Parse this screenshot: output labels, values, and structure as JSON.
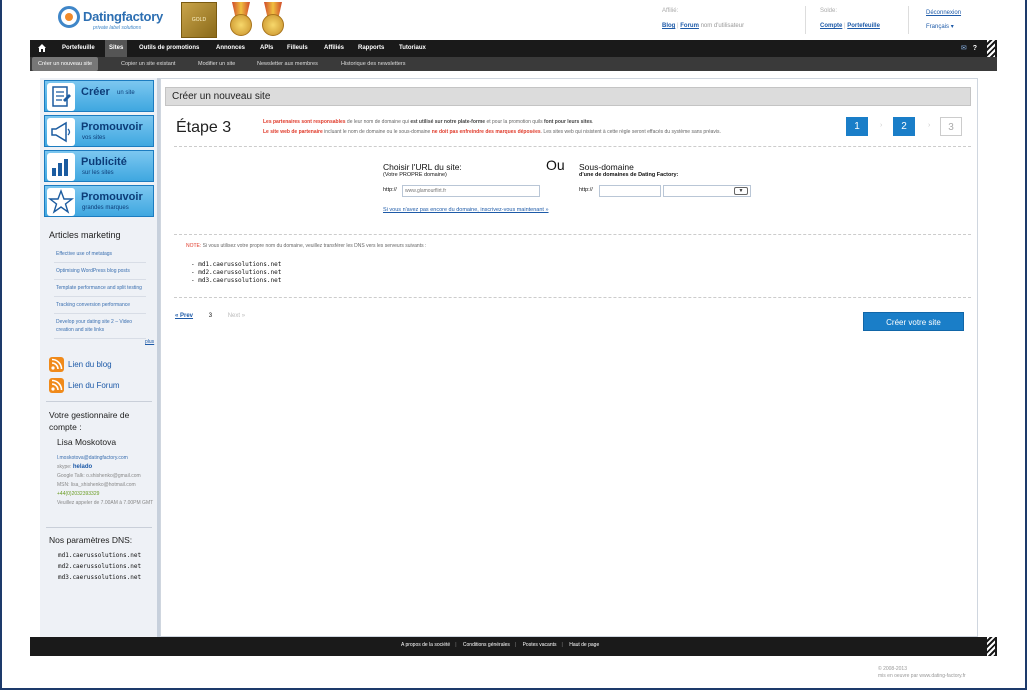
{
  "header": {
    "logo_name": "Datingfactory",
    "logo_tagline": "private label solutions",
    "award_text": "GOLD",
    "affiliate": {
      "label": "Affilié:",
      "blog": "Blog",
      "forum": "Forum",
      "suffix": "nom d'utilisateur"
    },
    "balance": {
      "label": "Solde:",
      "compte": "Compte",
      "portefeuille": "Portefeuille"
    },
    "account": {
      "logout": "Déconnexion",
      "language": "Français"
    }
  },
  "nav": {
    "items": [
      "Portefeuille",
      "Sites",
      "Outils de promotions",
      "Annonces",
      "APIs",
      "Filleuls",
      "Affiliés",
      "Rapports",
      "Tutoriaux"
    ],
    "active": "Sites",
    "icons": [
      "mail-icon",
      "help-icon"
    ]
  },
  "subnav": {
    "items": [
      "Créer un nouveau site",
      "Copier un site existant",
      "Modifier un site",
      "Newsletter aux membres",
      "Historique des newsletters"
    ]
  },
  "sidebar": {
    "buttons": [
      {
        "title": "Créer",
        "sub": "un site"
      },
      {
        "title": "Promouvoir",
        "sub": "vos sites"
      },
      {
        "title": "Publicité",
        "sub": "sur les sites"
      },
      {
        "title": "Promouvoir",
        "sub": "grandes marques"
      }
    ],
    "articles_heading": "Articles marketing",
    "articles": [
      "Effective use of metatags",
      "Optimising WordPress blog posts",
      "Template performance and split testing",
      "Tracking conversion performance",
      "Develop your dating site 2 – Video creation and site links"
    ],
    "more": "plus",
    "blog_link": "Lien du blog",
    "forum_link": "Lien du Forum",
    "manager_heading": "Votre gestionnaire de compte :",
    "manager_name": "Lisa Moskotova",
    "manager_email": "l.moskotova@datingfactory.com",
    "skype_label": "skype:",
    "skype": "helado",
    "gtalk": "Google Talk: o.shishenko@gmail.com",
    "msn": "MSN: lisa_shishenko@hotmail.com",
    "phone": "+44(0)2032393329",
    "hours": "Veuillez appeler de 7.00AM à 7.00PM GMT",
    "dns_heading": "Nos paramètres DNS:",
    "dns": [
      "md1.caerussolutions.net",
      "md2.caerussolutions.net",
      "md3.caerussolutions.net"
    ]
  },
  "main": {
    "title": "Créer un nouveau site",
    "step_label": "Étape 3",
    "desc_red1": "Les partenaires sont responsables",
    "desc_mid1": " de leur nom de domaine qui ",
    "desc_b1": "est utilisé sur notre plate-forme",
    "desc_mid2": " et pour la promotion quils ",
    "desc_b2": "font pour leurs sites",
    "desc_end1": ".",
    "desc_red2": "Le site web de partenaire",
    "desc_mid3": " incluant le nom de domaine ou le sous-domaine ",
    "desc_red3": "ne doit pas enfreindre des marques déposées",
    "desc_end2": ". Les sites web qui nisistent à cette règle seront effacés du système sans préavis.",
    "steps": [
      "1",
      "2",
      "3"
    ],
    "url_title": "Choisir l'URL du site:",
    "url_sub": "(Votre PROPRE domaine)",
    "or": "Ou",
    "subdomain_title": "Sous-domaine",
    "subdomain_sub": "d'une de domaines de Dating Factory:",
    "http_prefix": "http://",
    "url_placeholder": "www.glamourflirt.fr",
    "hint": "Si vous n'avez pas encore du domaine, inscrivez-vous maintenant »",
    "note_label": "NOTE:",
    "note_text": " Si vous utilisez votre propre nom du domaine, veuillez transférer les DNS vers les serveurs suivants :",
    "dns": [
      "- md1.caerussolutions.net",
      "- md2.caerussolutions.net",
      "- md3.caerussolutions.net"
    ],
    "prev": "« Prev",
    "current": "3",
    "next": "Next »",
    "create_button": "Créer votre site"
  },
  "footer": {
    "links": [
      "A propos de la société",
      "Conditions générales",
      "Postes vacants",
      "Haut de page"
    ],
    "copyright_line1": "© 2008-2013",
    "copyright_line2": "mis en oeuvre par www.dating-factory.fr"
  }
}
